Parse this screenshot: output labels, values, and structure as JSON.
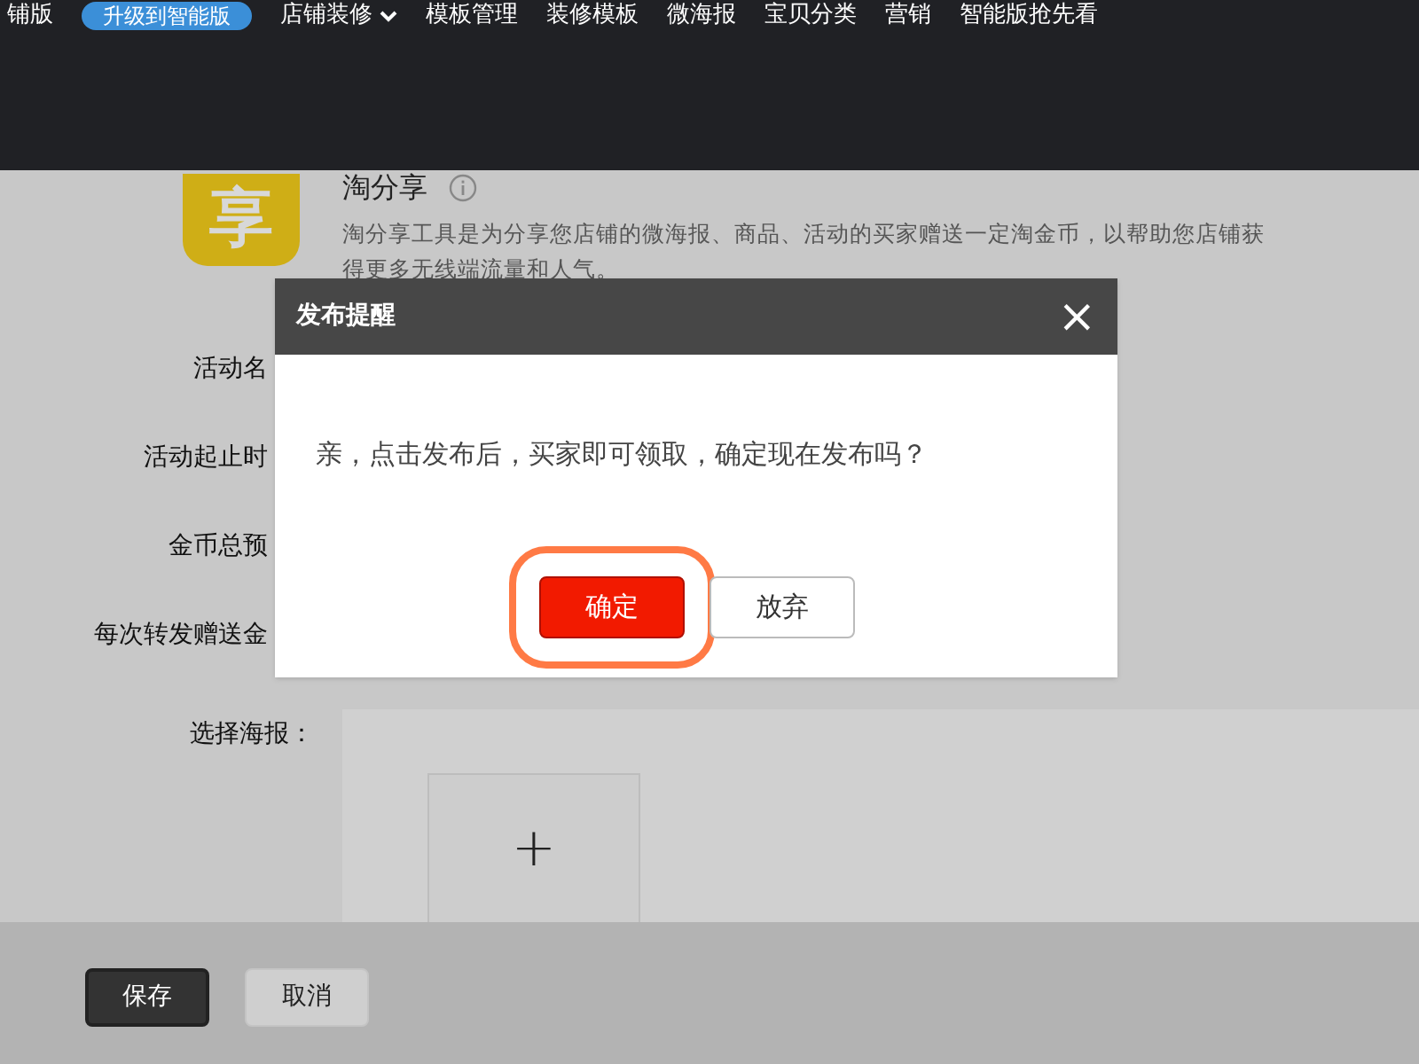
{
  "nav": {
    "items": [
      {
        "label": "铺版",
        "kind": "text"
      },
      {
        "label": "升级到智能版",
        "kind": "badge"
      },
      {
        "label": "店铺装修",
        "kind": "dropdown"
      },
      {
        "label": "模板管理",
        "kind": "text"
      },
      {
        "label": "装修模板",
        "kind": "text"
      },
      {
        "label": "微海报",
        "kind": "text"
      },
      {
        "label": "宝贝分类",
        "kind": "text"
      },
      {
        "label": "营销",
        "kind": "text"
      },
      {
        "label": "智能版抢先看",
        "kind": "text"
      }
    ]
  },
  "app": {
    "icon_glyph": "享",
    "title": "淘分享",
    "description": "淘分享工具是为分享您店铺的微海报、商品、活动的买家赠送一定淘金币，以帮助您店铺获得更多无线端流量和人气。"
  },
  "form": {
    "labels": [
      "活动名",
      "活动起止时",
      "金币总预",
      "每次转发赠送金"
    ],
    "poster_label": "选择海报：",
    "add_glyph": "+"
  },
  "footer": {
    "buttons": [
      {
        "label": "保存",
        "kind": "primary"
      },
      {
        "label": "取消",
        "kind": "secondary"
      }
    ]
  },
  "dialog": {
    "title": "发布提醒",
    "close": "×",
    "message": "亲，点击发布后，买家即可领取，确定现在发布吗？",
    "buttons": [
      {
        "label": "确定",
        "kind": "primary",
        "highlighted": true
      },
      {
        "label": "放弃",
        "kind": "secondary",
        "highlighted": false
      }
    ]
  }
}
